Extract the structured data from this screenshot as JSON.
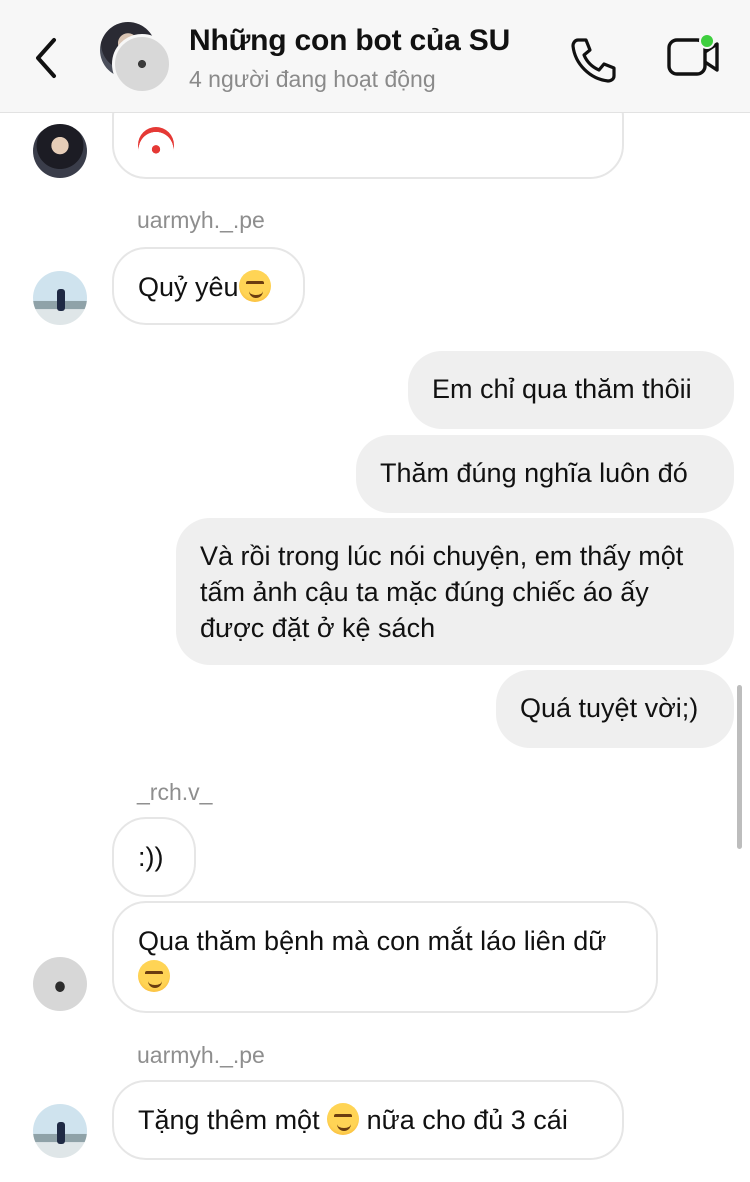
{
  "header": {
    "title": "Những con bot của SU",
    "subtitle": "4 người đang hoạt động",
    "active_color": "#3ecf3e"
  },
  "messages": {
    "m0_partial_emoji": "clown-emoji",
    "sender_1": "uarmyh._.pe",
    "m1_text": "Quỷ yêu",
    "m1_emoji": "smirk-emoji",
    "out_1": "Em chỉ qua thăm thôii",
    "out_2": "Thăm đúng nghĩa luôn đó",
    "out_3": "Và rồi trong lúc nói chuyện, em thấy một tấm ảnh cậu ta mặc đúng chiếc áo ấy được đặt ở kệ sách",
    "out_4": "Quá tuyệt vời;)",
    "sender_2": "_rch.v_",
    "m2_text": ":))",
    "m3_text": "Qua thăm bệnh mà con mắt láo liên dữ",
    "sender_3": "uarmyh._.pe",
    "m4_part1": "Tặng thêm một",
    "m4_part2": "nữa cho đủ 3 cái"
  }
}
